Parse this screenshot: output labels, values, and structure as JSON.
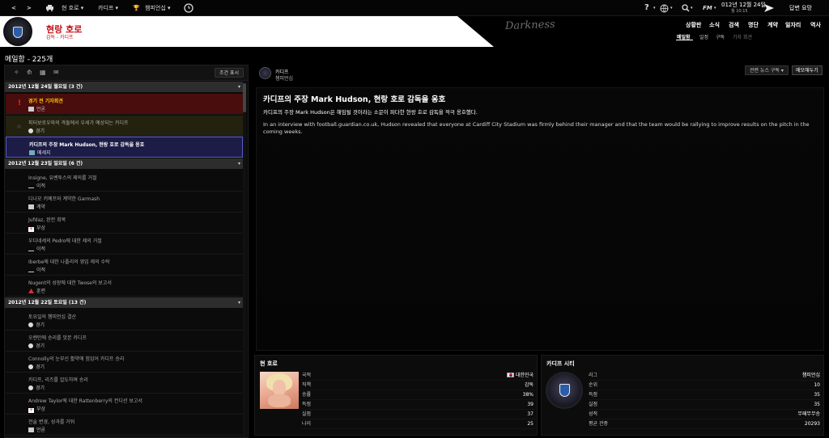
{
  "topbar": {
    "club_name": "현 호로",
    "team_name": "카디프",
    "competition": "챔피언십",
    "date_line": "012년 12월 24일",
    "time_line": "월 10:15",
    "continue_label": "답변 요망",
    "fm_label": "FM"
  },
  "header": {
    "manager_name": "현랑 호로",
    "manager_sub": "감독 - 카디프",
    "skin_name": "Darkness",
    "nav": [
      "상황판",
      "소식",
      "검색",
      "명단",
      "계약",
      "일자리",
      "역사"
    ],
    "subnav": [
      "메일함",
      "일정",
      "구독",
      "기자 회견"
    ]
  },
  "page_title": "메일함 - 225개",
  "inbox": {
    "filter_label": "조건 표시",
    "groups": [
      {
        "date": "2012년 12월 24일 월요일 (3 건)",
        "messages": [
          {
            "title": "경기 전 기자회견",
            "tag": "언론",
            "style": "red"
          },
          {
            "title": "피터보로우와의 격돌에서 우세가 예상되는 카디프",
            "tag": "경기",
            "style": "olive"
          },
          {
            "title": "카디프의 주장 Mark Hudson, 현랑 호로 감독을 옹호",
            "tag": "메세지",
            "style": "sel"
          }
        ]
      },
      {
        "date": "2012년 12월 23일 일요일 (6 건)",
        "messages": [
          {
            "title": "Insigne, 유벤투스의 제의를 거절",
            "tag": "이적"
          },
          {
            "title": "디나모 키예프와 계약한 Garmash",
            "tag": "계약"
          },
          {
            "title": "Jufdaz, 완전 회복",
            "tag": "부상"
          },
          {
            "title": "우디네세의 Pedro에 대한 제의 거절",
            "tag": "이적"
          },
          {
            "title": "Iberbe에 대한 나폴리의 영입 제의 수락",
            "tag": "이적"
          },
          {
            "title": "Nugent의 성장에 대한 Twose의 보고서",
            "tag": "훈련"
          }
        ]
      },
      {
        "date": "2012년 12월 22일 토요일 (13 건)",
        "messages": [
          {
            "title": "토요일의 챔피언십 결산",
            "tag": "경기"
          },
          {
            "title": "오렌만에 승리를 맛본 카디프",
            "tag": "경기"
          },
          {
            "title": "Connolly의 눈부신 활약에 힘입어 카디프 승리",
            "tag": "경기"
          },
          {
            "title": "카디프, 리즈를 압도하며 승리",
            "tag": "경기"
          },
          {
            "title": "Andrew Taylor에 대한 Rattenberry의 컨디션 보고서",
            "tag": "부상"
          },
          {
            "title": "전술 변경, 성과를 거둬",
            "tag": "언론"
          }
        ]
      }
    ]
  },
  "article": {
    "source_name": "카디프",
    "source_sub": "챔피언십",
    "related_label": "관련 뉴스 구독 ▾",
    "memo_label": "메모해두기",
    "title": "카디프의 주장 Mark Hudson, 현랑 호로 감독을 옹호",
    "lead": "카디프의 주장 Mark Hudson은 해임될 것이라는 소문이 파다한 현랑 호로 감독을 적극 옹호했다.",
    "body": "In an interview with football.guardian.co.uk, Hudson revealed that everyone at Cardiff City Stadium was firmly behind their manager and that the team would be rallying to improve results on the pitch in the coming weeks."
  },
  "manager_card": {
    "title": "현 호로",
    "rows": [
      {
        "k": "국적",
        "v": "대한민국"
      },
      {
        "k": "직책",
        "v": "감독"
      },
      {
        "k": "승률",
        "v": "38%"
      },
      {
        "k": "득점",
        "v": "39"
      },
      {
        "k": "실점",
        "v": "37"
      },
      {
        "k": "나이",
        "v": "25"
      }
    ]
  },
  "club_card": {
    "title": "카디프 시티",
    "rows": [
      {
        "k": "리그",
        "v": "챔피언십"
      },
      {
        "k": "순위",
        "v": "10"
      },
      {
        "k": "득점",
        "v": "35"
      },
      {
        "k": "실점",
        "v": "35"
      },
      {
        "k": "성적",
        "v": "무패무무승"
      },
      {
        "k": "평균 관중",
        "v": "20293"
      }
    ]
  }
}
